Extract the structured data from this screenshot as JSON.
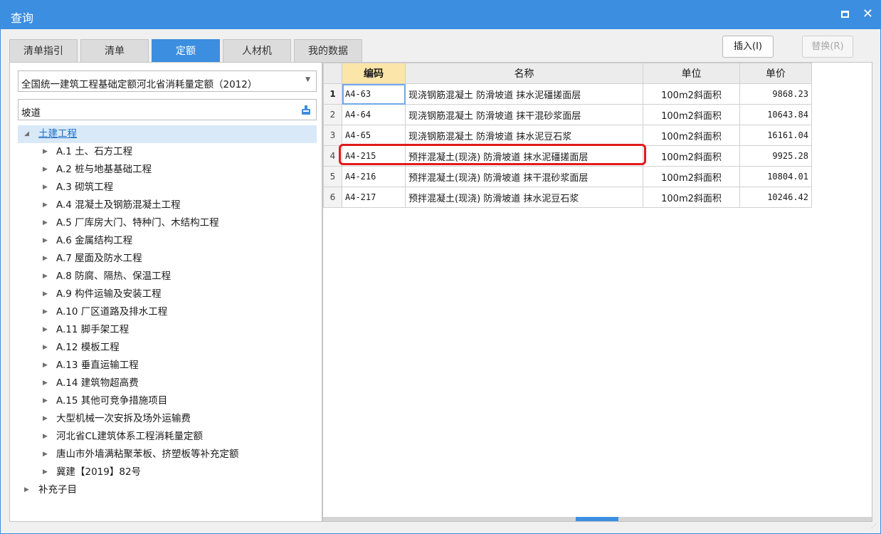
{
  "window": {
    "title": "查询"
  },
  "tabs": [
    {
      "label": "清单指引"
    },
    {
      "label": "清单"
    },
    {
      "label": "定额"
    },
    {
      "label": "人材机"
    },
    {
      "label": "我的数据"
    }
  ],
  "buttons": {
    "insert": "插入(I)",
    "replace": "替换(R)"
  },
  "left": {
    "library": "全国统一建筑工程基础定额河北省消耗量定额（2012）",
    "search_value": "坡道",
    "tree": [
      {
        "label": "土建工程",
        "level": 0,
        "expanded": true,
        "selected": true
      },
      {
        "label": "A.1 土、石方工程",
        "level": 1
      },
      {
        "label": "A.2 桩与地基基础工程",
        "level": 1
      },
      {
        "label": "A.3 砌筑工程",
        "level": 1
      },
      {
        "label": "A.4 混凝土及钢筋混凝土工程",
        "level": 1
      },
      {
        "label": "A.5 厂库房大门、特种门、木结构工程",
        "level": 1
      },
      {
        "label": "A.6 金属结构工程",
        "level": 1
      },
      {
        "label": "A.7 屋面及防水工程",
        "level": 1
      },
      {
        "label": "A.8 防腐、隔热、保温工程",
        "level": 1
      },
      {
        "label": "A.9 构件运输及安装工程",
        "level": 1
      },
      {
        "label": "A.10 厂区道路及排水工程",
        "level": 1
      },
      {
        "label": "A.11 脚手架工程",
        "level": 1
      },
      {
        "label": "A.12 模板工程",
        "level": 1
      },
      {
        "label": "A.13 垂直运输工程",
        "level": 1
      },
      {
        "label": "A.14 建筑物超高费",
        "level": 1
      },
      {
        "label": "A.15 其他可竞争措施项目",
        "level": 1
      },
      {
        "label": "大型机械一次安拆及场外运输费",
        "level": 1
      },
      {
        "label": "河北省CL建筑体系工程消耗量定额",
        "level": 1
      },
      {
        "label": "唐山市外墙满粘聚苯板、挤塑板等补充定额",
        "level": 1
      },
      {
        "label": "冀建【2019】82号",
        "level": 1
      },
      {
        "label": "补充子目",
        "level": 0
      }
    ]
  },
  "grid": {
    "columns": {
      "code": "编码",
      "name": "名称",
      "unit": "单位",
      "price": "单价"
    },
    "rows": [
      {
        "idx": "1",
        "code": "A4-63",
        "name": "现浇钢筋混凝土 防滑坡道 抹水泥礓搓面层",
        "unit": "100m2斜面积",
        "price": "9868.23"
      },
      {
        "idx": "2",
        "code": "A4-64",
        "name": "现浇钢筋混凝土 防滑坡道 抹干混砂浆面层",
        "unit": "100m2斜面积",
        "price": "10643.84"
      },
      {
        "idx": "3",
        "code": "A4-65",
        "name": "现浇钢筋混凝土 防滑坡道 抹水泥豆石浆",
        "unit": "100m2斜面积",
        "price": "16161.04"
      },
      {
        "idx": "4",
        "code": "A4-215",
        "name": "预拌混凝土(现浇) 防滑坡道 抹水泥礓搓面层",
        "unit": "100m2斜面积",
        "price": "9925.28"
      },
      {
        "idx": "5",
        "code": "A4-216",
        "name": "预拌混凝土(现浇) 防滑坡道 抹干混砂浆面层",
        "unit": "100m2斜面积",
        "price": "10804.01"
      },
      {
        "idx": "6",
        "code": "A4-217",
        "name": "预拌混凝土(现浇) 防滑坡道 抹水泥豆石浆",
        "unit": "100m2斜面积",
        "price": "10246.42"
      }
    ]
  },
  "colors": {
    "accent": "#3c8ee0",
    "highlight": "#e21a1a",
    "sorted_header": "#fbe5a8"
  }
}
